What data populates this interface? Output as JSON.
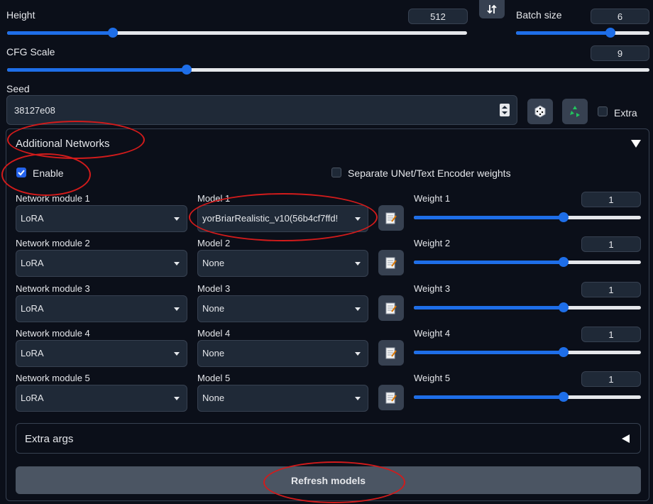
{
  "height": {
    "label": "Height",
    "value": "512",
    "fraction": 0.23
  },
  "swap_icon": "swap-vertical-icon",
  "batch_size": {
    "label": "Batch size",
    "value": "6",
    "fraction": 0.71
  },
  "cfg_scale": {
    "label": "CFG Scale",
    "value": "9",
    "fraction": 0.28
  },
  "seed": {
    "label": "Seed",
    "value": "38127e08",
    "extra_label": "Extra"
  },
  "additional_networks": {
    "title": "Additional Networks",
    "enable_label": "Enable",
    "enable_checked": true,
    "separate_label": "Separate UNet/Text Encoder weights",
    "separate_checked": false,
    "rows": [
      {
        "module_label": "Network module 1",
        "module_value": "LoRA",
        "model_label": "Model 1",
        "model_value": "yorBriarRealistic_v10(56b4cf7ffd!",
        "weight_label": "Weight 1",
        "weight_value": "1",
        "weight_fraction": 0.66
      },
      {
        "module_label": "Network module 2",
        "module_value": "LoRA",
        "model_label": "Model 2",
        "model_value": "None",
        "weight_label": "Weight 2",
        "weight_value": "1",
        "weight_fraction": 0.66
      },
      {
        "module_label": "Network module 3",
        "module_value": "LoRA",
        "model_label": "Model 3",
        "model_value": "None",
        "weight_label": "Weight 3",
        "weight_value": "1",
        "weight_fraction": 0.66
      },
      {
        "module_label": "Network module 4",
        "module_value": "LoRA",
        "model_label": "Model 4",
        "model_value": "None",
        "weight_label": "Weight 4",
        "weight_value": "1",
        "weight_fraction": 0.66
      },
      {
        "module_label": "Network module 5",
        "module_value": "LoRA",
        "model_label": "Model 5",
        "model_value": "None",
        "weight_label": "Weight 5",
        "weight_value": "1",
        "weight_fraction": 0.66
      }
    ],
    "extra_args_label": "Extra args",
    "refresh_label": "Refresh models"
  },
  "colors": {
    "accent": "#1e6ee8",
    "background": "#0b0f19",
    "annotation": "#d21b1b"
  }
}
